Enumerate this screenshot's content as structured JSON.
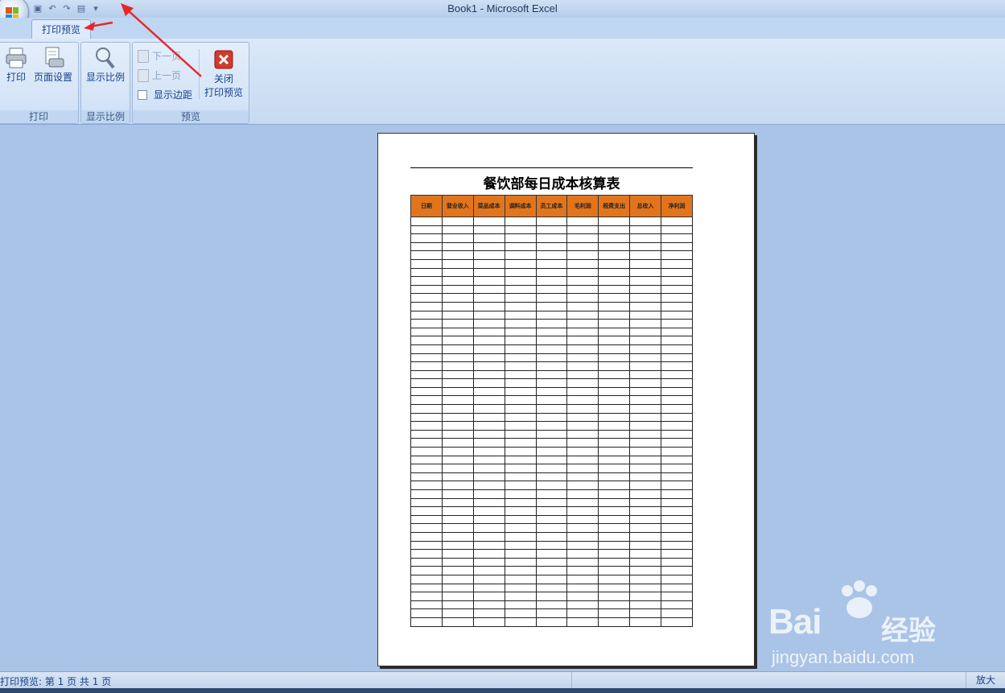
{
  "window": {
    "title": "Book1 - Microsoft Excel"
  },
  "ribbon": {
    "tab_label": "打印预览",
    "groups": {
      "print": {
        "label": "打印",
        "print_label": "打印",
        "page_setup_label": "页面设置"
      },
      "zoom": {
        "label": "显示比例",
        "zoom_label": "显示比例"
      },
      "preview": {
        "label": "预览",
        "next_page_label": "下一页",
        "prev_page_label": "上一页",
        "show_margins_label": "显示边距",
        "close_label_line1": "关闭",
        "close_label_line2": "打印预览"
      }
    }
  },
  "sheet": {
    "title": "餐饮部每日成本核算表",
    "headers": [
      "日期",
      "营业收入",
      "菜品成本",
      "调料成本",
      "员工成本",
      "毛利润",
      "税费支出",
      "总收入",
      "净利润"
    ],
    "header_color": "#e2751c",
    "row_count": 48
  },
  "statusbar": {
    "text": "打印预览: 第 1 页  共 1 页",
    "zoom_label": "放大"
  },
  "watermark": {
    "brand": "Bai",
    "brand_cn": "经验",
    "url": "jingyan.baidu.com"
  },
  "colors": {
    "workspace": "#a9c4e6",
    "ribbon_text": "#15428b"
  }
}
